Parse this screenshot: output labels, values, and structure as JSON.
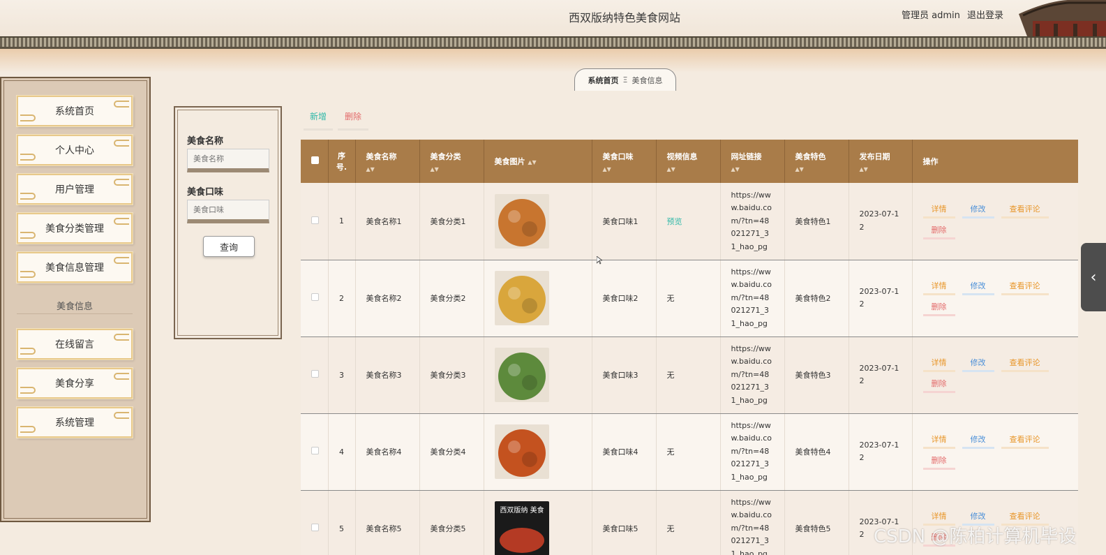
{
  "header": {
    "title": "西双版纳特色美食网站",
    "user_label": "管理员 admin",
    "logout_label": "退出登录"
  },
  "breadcrumb": {
    "home": "系统首页",
    "separator": "Ξ",
    "current": "美食信息"
  },
  "sidebar": {
    "items": [
      {
        "label": "系统首页"
      },
      {
        "label": "个人中心"
      },
      {
        "label": "用户管理"
      },
      {
        "label": "美食分类管理"
      },
      {
        "label": "美食信息管理"
      },
      {
        "label": "在线留言"
      },
      {
        "label": "美食分享"
      },
      {
        "label": "系统管理"
      }
    ],
    "sub_label": "美食信息"
  },
  "search": {
    "name_label": "美食名称",
    "name_placeholder": "美食名称",
    "flavor_label": "美食口味",
    "flavor_placeholder": "美食口味",
    "query_button": "查询"
  },
  "toolbar": {
    "add_label": "新增",
    "delete_label": "删除"
  },
  "table": {
    "headers": {
      "index": "序号.",
      "name": "美食名称",
      "category": "美食分类",
      "image": "美食图片",
      "flavor": "美食口味",
      "video": "视频信息",
      "url": "网址链接",
      "feature": "美食特色",
      "date": "发布日期",
      "ops": "操作"
    },
    "rows": [
      {
        "index": "1",
        "name": "美食名称1",
        "category": "美食分类1",
        "flavor": "美食口味1",
        "video": "预览",
        "url": "https://www.baidu.com/?tn=48021271_31_hao_pg",
        "feature": "美食特色1",
        "date": "2023-07-12",
        "image_color": "#c8752f"
      },
      {
        "index": "2",
        "name": "美食名称2",
        "category": "美食分类2",
        "flavor": "美食口味2",
        "video": "无",
        "url": "https://www.baidu.com/?tn=48021271_31_hao_pg",
        "feature": "美食特色2",
        "date": "2023-07-12",
        "image_color": "#d9a63c"
      },
      {
        "index": "3",
        "name": "美食名称3",
        "category": "美食分类3",
        "flavor": "美食口味3",
        "video": "无",
        "url": "https://www.baidu.com/?tn=48021271_31_hao_pg",
        "feature": "美食特色3",
        "date": "2023-07-12",
        "image_color": "#5d8a3c"
      },
      {
        "index": "4",
        "name": "美食名称4",
        "category": "美食分类4",
        "flavor": "美食口味4",
        "video": "无",
        "url": "https://www.baidu.com/?tn=48021271_31_hao_pg",
        "feature": "美食特色4",
        "date": "2023-07-12",
        "image_color": "#c4521f"
      },
      {
        "index": "5",
        "name": "美食名称5",
        "category": "美食分类5",
        "flavor": "美食口味5",
        "video": "无",
        "url": "https://www.baidu.com/?tn=48021271_31_hao_pg",
        "feature": "美食特色5",
        "date": "2023-07-12",
        "image_color": "#b43a24",
        "image_text": "西双版纳 美食"
      }
    ],
    "ops": {
      "detail": "详情",
      "edit": "修改",
      "comments": "查看评论",
      "delete": "删除"
    }
  },
  "watermark": "CSDN @陈柏计算机毕设",
  "colors": {
    "header_bar": "#a97c49",
    "add": "#2fb8a8",
    "delete": "#e36a6a",
    "edit": "#4a8fd8",
    "detail": "#e8962a"
  }
}
